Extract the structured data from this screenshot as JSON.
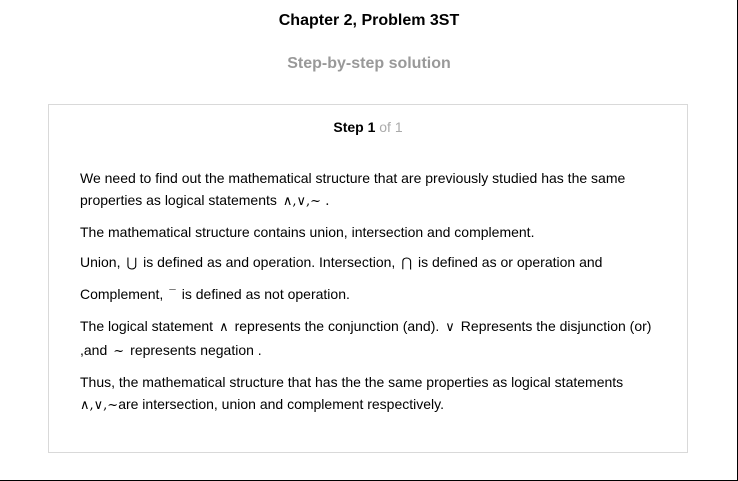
{
  "header": {
    "title": "Chapter 2, Problem 3ST",
    "subtitle": "Step-by-step solution"
  },
  "step": {
    "label": "Step 1",
    "of": " of 1"
  },
  "content": {
    "p1_text": "We need to find out the mathematical structure that are previously studied has the same properties as logical statements",
    "p1_symbols": "∧,∨,~ .",
    "p2": "The mathematical structure contains union, intersection and complement.",
    "p3_a": "Union,",
    "p3_union": "⋃",
    "p3_b": "is defined as and operation. Intersection,",
    "p3_intersection": "⋂",
    "p3_c": "is defined as or operation and",
    "p4_a": "Complement,",
    "p4_bar": "‾",
    "p4_b": "is defined as not operation.",
    "p5_a": "The logical statement",
    "p5_and": "∧",
    "p5_b": "represents the conjunction (and).",
    "p5_or": "∨",
    "p5_c": "Represents the disjunction (or) ,and",
    "p5_not": "~",
    "p5_d": "represents negation .",
    "p6_a": "Thus, the mathematical structure that has the the same properties as logical statements",
    "p6_symbols": "∧,∨,~",
    "p6_b": "are intersection, union and complement respectively."
  }
}
